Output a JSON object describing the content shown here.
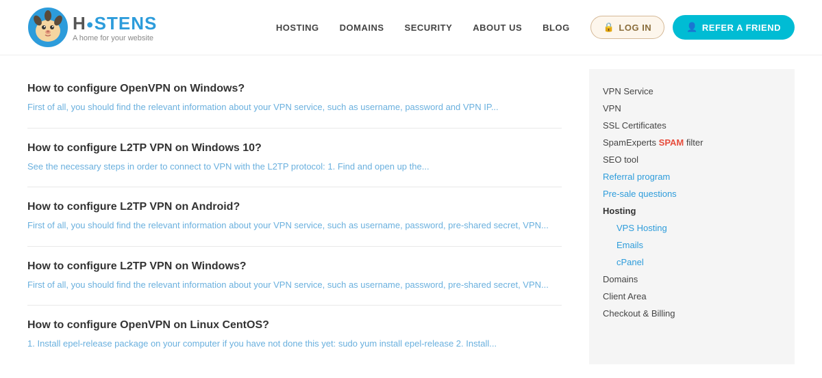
{
  "header": {
    "logo_brand": "H  STENS",
    "logo_tagline": "A home for your website",
    "nav_items": [
      {
        "label": "HOSTING",
        "href": "#"
      },
      {
        "label": "DOMAINS",
        "href": "#"
      },
      {
        "label": "SECURITY",
        "href": "#"
      },
      {
        "label": "ABOUT US",
        "href": "#"
      },
      {
        "label": "BLOG",
        "href": "#"
      }
    ],
    "login_label": "LOG IN",
    "refer_label": "REFER A FRIEND"
  },
  "articles": [
    {
      "title": "How to configure OpenVPN on Windows?",
      "excerpt": "First of all, you should find the relevant information about your VPN service, such as username, password and VPN IP..."
    },
    {
      "title": "How to configure L2TP VPN on Windows 10?",
      "excerpt": "See the necessary steps in order to connect to VPN with the L2TP protocol: 1. Find and open up the..."
    },
    {
      "title": "How to configure L2TP VPN on Android?",
      "excerpt": "First of all, you should find the relevant information about your VPN service, such as username, password, pre-shared secret, VPN..."
    },
    {
      "title": "How to configure L2TP VPN on Windows?",
      "excerpt": "First of all, you should find the relevant information about your VPN service, such as username, password, pre-shared secret, VPN..."
    },
    {
      "title": "How to configure OpenVPN on Linux CentOS?",
      "excerpt": "1. Install epel-release package on your computer if you have not done this yet: sudo yum install epel-release 2. Install..."
    }
  ],
  "sidebar": {
    "items": [
      {
        "label": "VPN Service",
        "type": "normal"
      },
      {
        "label": "VPN",
        "type": "normal"
      },
      {
        "label": "SSL Certificates",
        "type": "normal"
      },
      {
        "label": "SpamExperts SPAM filter",
        "type": "spam"
      },
      {
        "label": "SEO tool",
        "type": "normal"
      },
      {
        "label": "Referral program",
        "type": "blue"
      },
      {
        "label": "Pre-sale questions",
        "type": "blue"
      },
      {
        "label": "Hosting",
        "type": "bold"
      },
      {
        "label": "VPS Hosting",
        "type": "sub-blue"
      },
      {
        "label": "Emails",
        "type": "sub-blue"
      },
      {
        "label": "cPanel",
        "type": "sub-blue"
      },
      {
        "label": "Domains",
        "type": "normal"
      },
      {
        "label": "Client Area",
        "type": "normal"
      },
      {
        "label": "Checkout & Billing",
        "type": "normal"
      }
    ]
  }
}
